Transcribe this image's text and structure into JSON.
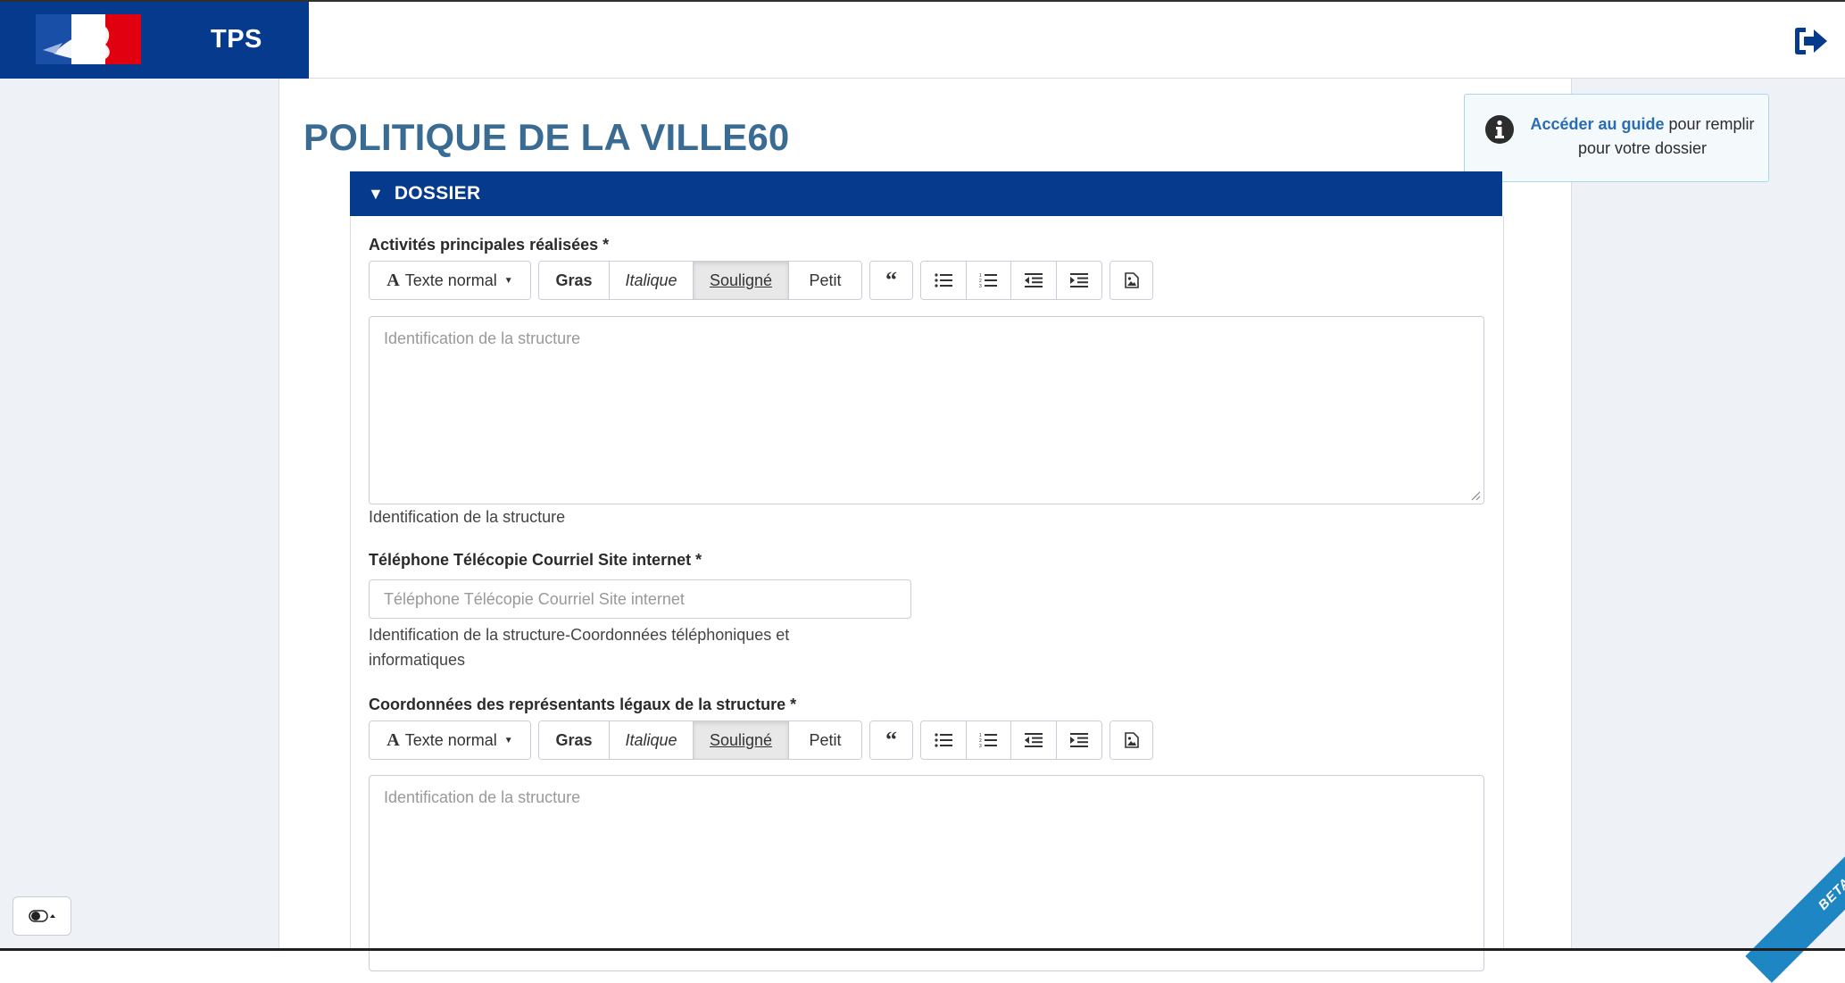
{
  "header": {
    "brand_title": "TPS",
    "logout_icon": "sign-out-icon"
  },
  "guide": {
    "link_text": "Accéder au guide",
    "text_after": " pour remplir pour votre dossier",
    "icon": "info-circle-icon"
  },
  "page": {
    "title": "POLITIQUE DE LA VILLE60"
  },
  "panel": {
    "caret": "▼",
    "title": "DOSSIER"
  },
  "toolbar": {
    "style_prefix": "A",
    "style_label": "Texte normal",
    "bold": "Gras",
    "italic": "Italique",
    "underline": "Souligné",
    "small": "Petit",
    "quote_icon": "“"
  },
  "fields": {
    "activites": {
      "label": "Activités principales réalisées *",
      "placeholder": "Identification de la structure",
      "help": "Identification de la structure"
    },
    "telephone": {
      "label": "Téléphone Télécopie Courriel Site internet *",
      "placeholder": "Téléphone Télécopie Courriel Site internet",
      "help": "Identification de la structure-Coordonnées téléphoniques et informatiques"
    },
    "representants": {
      "label": "Coordonnées des représentants légaux de la structure *",
      "placeholder": "Identification de la structure"
    }
  },
  "ribbon": {
    "label": "BETA"
  },
  "colors": {
    "primary_blue": "#063a8c",
    "title_blue": "#3a6b93",
    "ribbon_blue": "#1f86c4",
    "side_bg": "#eef2f6"
  }
}
